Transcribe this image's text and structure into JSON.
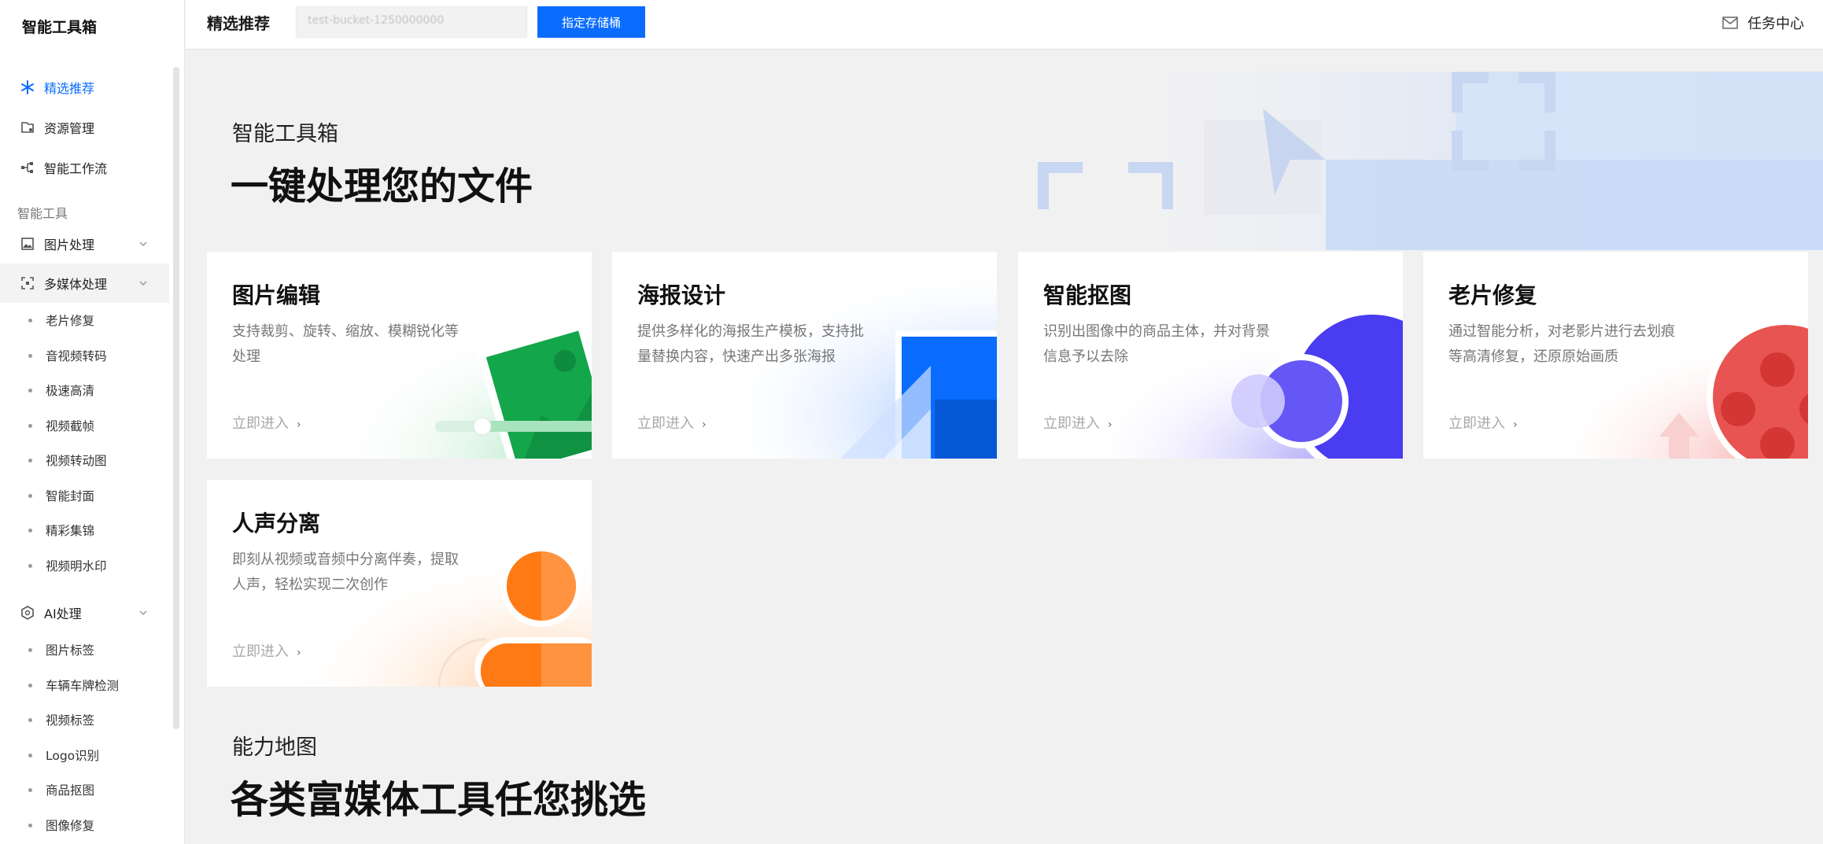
{
  "app": {
    "title": "智能工具箱"
  },
  "sidebar": {
    "top_items": [
      {
        "label": "精选推荐",
        "icon": "sparkle-icon",
        "active": true
      },
      {
        "label": "资源管理",
        "icon": "folder-icon",
        "active": false
      },
      {
        "label": "智能工作流",
        "icon": "workflow-icon",
        "active": false
      }
    ],
    "section_label": "智能工具",
    "groups": [
      {
        "label": "图片处理",
        "icon": "image-icon",
        "open": false,
        "items": []
      },
      {
        "label": "多媒体处理",
        "icon": "scan-icon",
        "open": true,
        "items": [
          "老片修复",
          "音视频转码",
          "极速高清",
          "视频截帧",
          "视频转动图",
          "智能封面",
          "精彩集锦",
          "视频明水印"
        ]
      },
      {
        "label": "AI处理",
        "icon": "ai-icon",
        "open": true,
        "items": [
          "图片标签",
          "车辆车牌检测",
          "视频标签",
          "Logo识别",
          "商品抠图",
          "图像修复"
        ]
      }
    ]
  },
  "header": {
    "title": "精选推荐",
    "bucket_value": "test-bucket-1250000000",
    "bucket_button": "指定存储桶",
    "task_center": "任务中心"
  },
  "hero": {
    "subtitle": "智能工具箱",
    "title": "一键处理您的文件"
  },
  "cards": [
    {
      "title": "图片编辑",
      "desc": "支持裁剪、旋转、缩放、模糊锐化等处理",
      "link": "立即进入",
      "color": "#14a64b"
    },
    {
      "title": "海报设计",
      "desc": "提供多样化的海报生产模板，支持批量替换内容，快速产出多张海报",
      "link": "立即进入",
      "color": "#0a6cff"
    },
    {
      "title": "智能抠图",
      "desc": "识别出图像中的商品主体，并对背景信息予以去除",
      "link": "立即进入",
      "color": "#4a3cf0"
    },
    {
      "title": "老片修复",
      "desc": "通过智能分析，对老影片进行去划痕等高清修复，还原原始画质",
      "link": "立即进入",
      "color": "#e8413e"
    },
    {
      "title": "人声分离",
      "desc": "即刻从视频或音频中分离伴奏，提取人声，轻松实现二次创作",
      "link": "立即进入",
      "color": "#ff7a14"
    }
  ],
  "section2": {
    "subtitle": "能力地图",
    "title": "各类富媒体工具任您挑选"
  },
  "colors": {
    "accent": "#0a6cff",
    "sidebar_bg": "#ffffff",
    "page_bg": "#f1f1f1"
  }
}
